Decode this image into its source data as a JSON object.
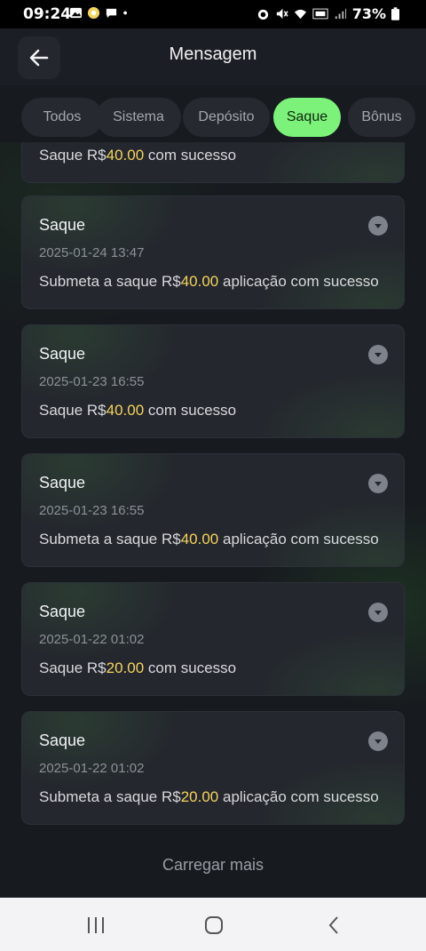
{
  "status_bar": {
    "time": "09:24",
    "battery": "73%",
    "left_icons": [
      "image-icon",
      "coin-icon",
      "chat-icon",
      "dot-icon"
    ],
    "right_icons": [
      "alarm-icon",
      "mute-icon",
      "wifi-icon",
      "volte-icon",
      "signal-icon",
      "battery-icon"
    ]
  },
  "header": {
    "title": "Mensagem",
    "back_icon": "arrow-left-icon"
  },
  "tabs": [
    {
      "label": "Todos",
      "active": false
    },
    {
      "label": "Sistema",
      "active": false
    },
    {
      "label": "Depósito",
      "active": false
    },
    {
      "label": "Saque",
      "active": true
    },
    {
      "label": "Bônus",
      "active": false
    }
  ],
  "partial_card": {
    "prefix": "Saque R$",
    "amount": "40.00",
    "suffix": " com sucesso"
  },
  "messages": [
    {
      "title": "Saque",
      "date": "2025-01-24 13:47",
      "prefix": "Submeta a saque R$",
      "amount": "40.00",
      "suffix": " aplicação com sucesso"
    },
    {
      "title": "Saque",
      "date": "2025-01-23 16:55",
      "prefix": "Saque R$",
      "amount": "40.00",
      "suffix": " com sucesso"
    },
    {
      "title": "Saque",
      "date": "2025-01-23 16:55",
      "prefix": "Submeta a saque R$",
      "amount": "40.00",
      "suffix": " aplicação com sucesso"
    },
    {
      "title": "Saque",
      "date": "2025-01-22 01:02",
      "prefix": "Saque R$",
      "amount": "20.00",
      "suffix": " com sucesso"
    },
    {
      "title": "Saque",
      "date": "2025-01-22 01:02",
      "prefix": "Submeta a saque R$",
      "amount": "20.00",
      "suffix": " aplicação com sucesso"
    }
  ],
  "load_more": "Carregar mais",
  "colors": {
    "accent": "#7cf27a",
    "amount": "#f5d45a",
    "background": "#171a1f",
    "card": "#24272e"
  }
}
